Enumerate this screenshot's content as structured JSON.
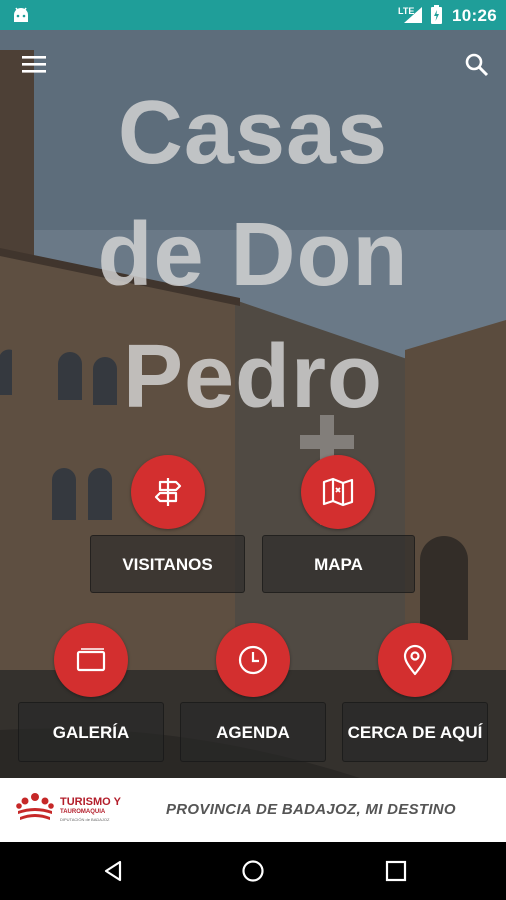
{
  "status_bar": {
    "time": "10:26",
    "network": "LTE",
    "icons": [
      "android-icon",
      "signal-icon",
      "battery-icon"
    ]
  },
  "app_bar": {
    "menu_icon": "menu-icon",
    "search_icon": "search-icon"
  },
  "hero": {
    "title_line1": "Casas",
    "title_line2": "de Don",
    "title_line3": "Pedro"
  },
  "menu": {
    "visitanos": {
      "label": "VISITANOS",
      "icon": "signpost-icon"
    },
    "mapa": {
      "label": "MAPA",
      "icon": "map-icon"
    },
    "galeria": {
      "label": "GALERÍA",
      "icon": "gallery-icon"
    },
    "agenda": {
      "label": "AGENDA",
      "icon": "clock-icon"
    },
    "cerca": {
      "label": "CERCA DE AQUÍ",
      "icon": "location-pin-icon"
    }
  },
  "footer": {
    "logo_line1": "TURISMO Y",
    "logo_line2": "TAUROMAQUIA",
    "logo_line3": "DIPUTACIÓN de BADAJOZ",
    "tagline": "PROVINCIA DE BADAJOZ, MI DESTINO"
  },
  "nav_bar": {
    "icons": [
      "back-icon",
      "home-icon",
      "recents-icon"
    ]
  },
  "colors": {
    "status_bar": "#1f9e99",
    "accent_red": "#d32f2f",
    "tile_bg": "rgba(40,40,40,0.6)"
  }
}
